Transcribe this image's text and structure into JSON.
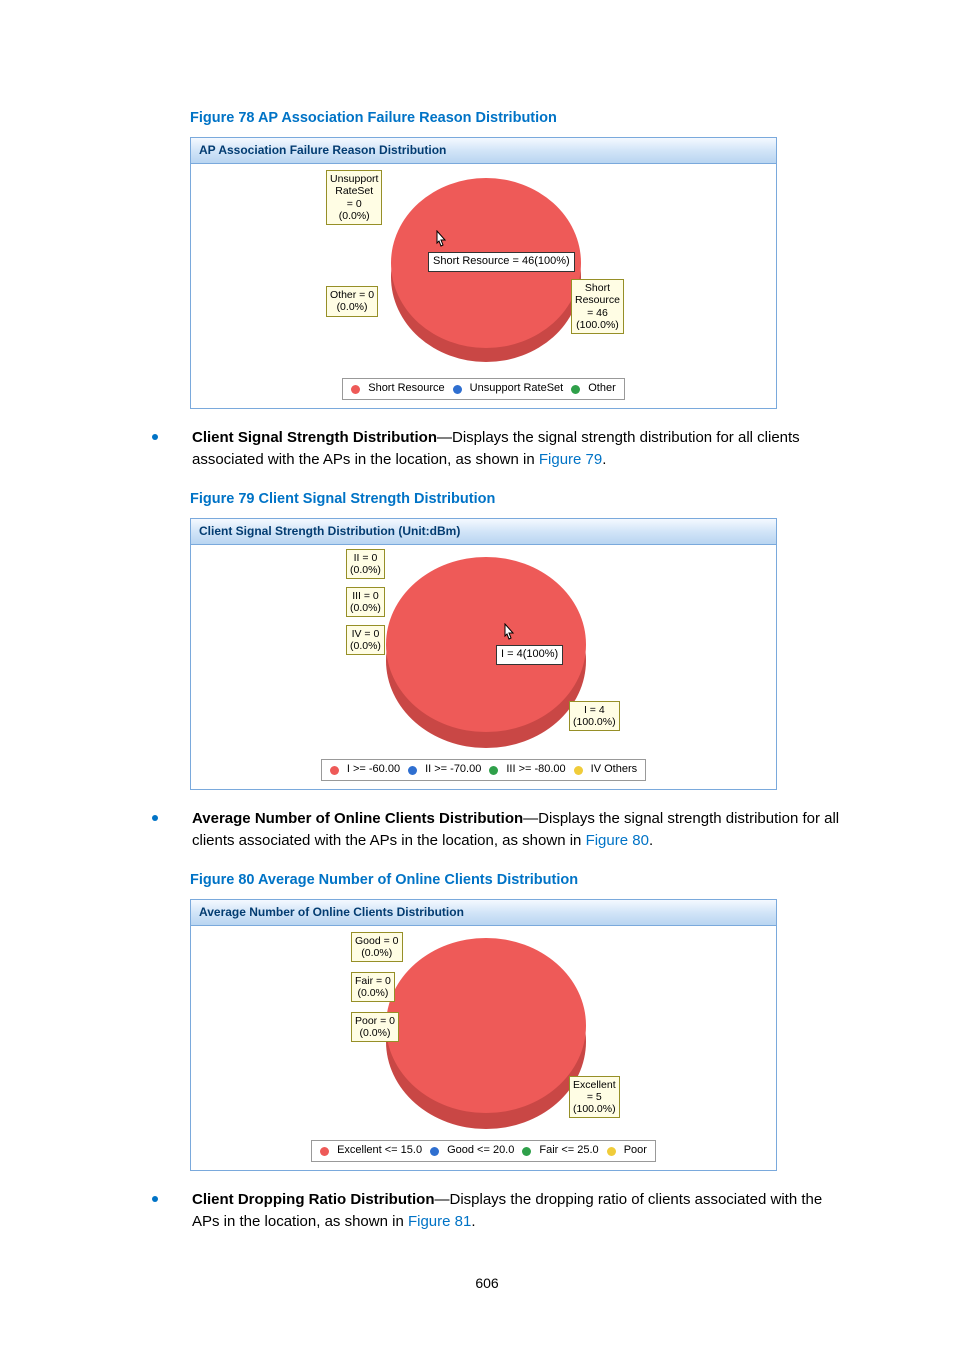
{
  "page_number": "606",
  "fig78": {
    "caption": "Figure 78 AP Association Failure Reason Distribution",
    "panel_title": "AP Association Failure Reason Distribution",
    "labels": {
      "unsupport": "Unsupport\nRateSet\n= 0\n(0.0%)",
      "other": "Other = 0\n(0.0%)",
      "short": "Short\nResource\n= 46\n(100.0%)",
      "tooltip": "Short Resource = 46(100%)"
    },
    "legend": {
      "i": "Short Resource",
      "ii": "Unsupport RateSet",
      "iii": "Other"
    }
  },
  "bullet79": {
    "lead": "Client Signal Strength Distribution",
    "text": "—Displays the signal strength distribution for all clients associated with the APs in the location, as shown in ",
    "link": "Figure 79",
    "tail": "."
  },
  "fig79": {
    "caption": "Figure 79 Client Signal Strength Distribution",
    "panel_title": "Client Signal Strength Distribution (Unit:dBm)",
    "labels": {
      "ii": "II = 0\n(0.0%)",
      "iii": "III = 0\n(0.0%)",
      "iv": "IV = 0\n(0.0%)",
      "i": "I = 4\n(100.0%)",
      "tooltip": "I = 4(100%)"
    },
    "legend": {
      "i": "I >= -60.00",
      "ii": "II >= -70.00",
      "iii": "III >= -80.00",
      "iv": "IV Others"
    }
  },
  "bullet80": {
    "lead": "Average Number of Online Clients Distribution",
    "text": "—Displays the signal strength distribution for all clients associated with the APs in the location, as shown in ",
    "link": "Figure 80",
    "tail": "."
  },
  "fig80": {
    "caption": "Figure 80 Average Number of Online Clients Distribution",
    "panel_title": "Average Number of Online Clients Distribution",
    "labels": {
      "good": "Good = 0\n(0.0%)",
      "fair": "Fair = 0\n(0.0%)",
      "poor": "Poor = 0\n(0.0%)",
      "excellent": "Excellent\n= 5\n(100.0%)"
    },
    "legend": {
      "i": "Excellent <= 15.0",
      "ii": "Good <= 20.0",
      "iii": "Fair <= 25.0",
      "iv": "Poor"
    }
  },
  "bullet81": {
    "lead": "Client Dropping Ratio Distribution",
    "text": "—Displays the dropping ratio of clients associated with the APs in the location, as shown in ",
    "link": "Figure 81",
    "tail": "."
  },
  "colors": {
    "red": "#ee5a58",
    "blue": "#2f6fd0",
    "green": "#2fa04a",
    "yellow": "#f0cc3a"
  },
  "chart_data": [
    {
      "figure": 78,
      "title": "AP Association Failure Reason Distribution",
      "type": "pie",
      "categories": [
        "Short Resource",
        "Unsupport RateSet",
        "Other"
      ],
      "values": [
        46,
        0,
        0
      ],
      "percent": [
        100.0,
        0.0,
        0.0
      ]
    },
    {
      "figure": 79,
      "title": "Client Signal Strength Distribution (Unit:dBm)",
      "type": "pie",
      "categories": [
        "I >= -60.00",
        "II >= -70.00",
        "III >= -80.00",
        "IV Others"
      ],
      "values": [
        4,
        0,
        0,
        0
      ],
      "percent": [
        100.0,
        0.0,
        0.0,
        0.0
      ]
    },
    {
      "figure": 80,
      "title": "Average Number of Online Clients Distribution",
      "type": "pie",
      "categories": [
        "Excellent <= 15.0",
        "Good <= 20.0",
        "Fair <= 25.0",
        "Poor"
      ],
      "values": [
        5,
        0,
        0,
        0
      ],
      "percent": [
        100.0,
        0.0,
        0.0,
        0.0
      ]
    }
  ]
}
